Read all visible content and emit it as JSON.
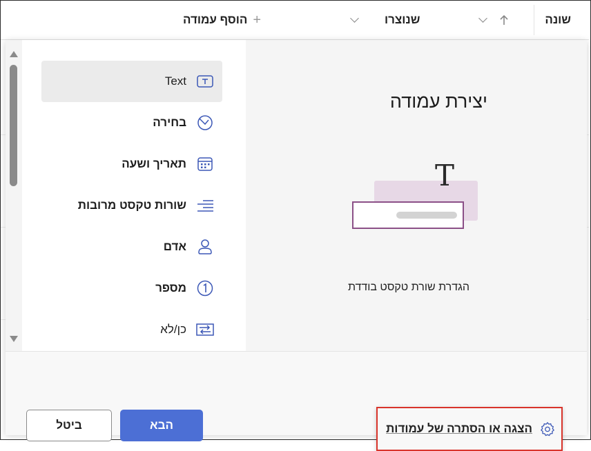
{
  "header": {
    "columns": [
      {
        "label": "שונה"
      },
      {
        "label": "שנוצרו"
      },
      {
        "label": "הוסף עמודה"
      }
    ],
    "add_icon": "plus-icon"
  },
  "field_types": [
    {
      "label": "Text",
      "icon": "text-icon",
      "selected": true
    },
    {
      "label": "בחירה",
      "icon": "choice-icon"
    },
    {
      "label": "תאריך ושעה",
      "icon": "calendar-icon"
    },
    {
      "label": "שורות טקסט מרובות",
      "icon": "multiline-icon"
    },
    {
      "label": "אדם",
      "icon": "person-icon"
    },
    {
      "label": "מספר",
      "icon": "number-icon"
    },
    {
      "label": "כן/לא",
      "icon": "yes-no-icon"
    }
  ],
  "preview": {
    "title": "יצירת עמודה",
    "description": "הגדרת שורת טקסט בודדת"
  },
  "footer": {
    "show_hide_link": "הצגה או הסתרה של עמודות",
    "next_label": "הבא",
    "cancel_label": "ביטל"
  },
  "colors": {
    "primary": "#4c6fd5",
    "highlight_border": "#d9342b",
    "accent_icon": "#3b57b6"
  }
}
